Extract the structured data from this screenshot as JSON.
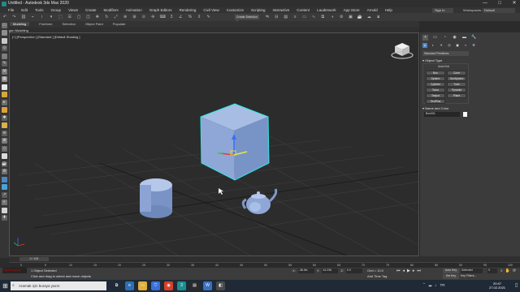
{
  "window": {
    "title": "Untitled - Autodesk 3ds Max 2020",
    "controls": [
      "—",
      "□",
      "✕"
    ]
  },
  "menubar": {
    "items": [
      "File",
      "Edit",
      "Tools",
      "Group",
      "Views",
      "Create",
      "Modifiers",
      "Animation",
      "Graph Editors",
      "Rendering",
      "Civil View",
      "Customize",
      "Scripting",
      "Interactive",
      "Content",
      "Lauderwork",
      "App Store",
      "Arnold",
      "Help"
    ],
    "signin": "Sign In",
    "workspaces_label": "Workspaces:",
    "workspaces_value": "Default"
  },
  "toolbar": {
    "selection_set": "Create Selection Se"
  },
  "ribbon": {
    "tabs": [
      "Modeling",
      "Freeform",
      "Selection",
      "Object Paint",
      "Populate"
    ],
    "active_tab": "Modeling",
    "sub_label": "Polygon Modeling"
  },
  "viewport": {
    "label": "[+] [Perspective ] [Standard ] [Default Shading ]"
  },
  "command_panel": {
    "tab_icons": [
      "+",
      "▭",
      "◔",
      "◉",
      "▬",
      "🔧"
    ],
    "category_icons": [
      "●",
      "◐",
      "☀",
      "◎",
      "▣",
      "≈",
      "⚙"
    ],
    "primitive_type": "Standard Primitives",
    "object_type_header": "Object Type",
    "autogrid": "AutoGrid",
    "object_buttons": [
      "Box",
      "Cone",
      "Sphere",
      "GeoSphere",
      "Cylinder",
      "Tube",
      "Torus",
      "Pyramid",
      "Teapot",
      "Plane",
      "TextPlus"
    ],
    "name_color_header": "Name and Color",
    "object_name": "Box001",
    "object_color": "#ffffff"
  },
  "timeline": {
    "slider": "0 / 100",
    "ticks": [
      "0",
      "5",
      "10",
      "15",
      "20",
      "25",
      "30",
      "35",
      "40",
      "45",
      "50",
      "55",
      "60",
      "65",
      "70",
      "75",
      "80",
      "85",
      "90",
      "95",
      "100"
    ]
  },
  "statusbar": {
    "maxscript": "MAXScript Mi",
    "status_line1": "1 Object Selected",
    "status_line2": "Click and drag to select and move objects",
    "x_label": "X:",
    "x_value": "-36.9in",
    "y_label": "Y:",
    "y_value": "24.236",
    "z_label": "Z:",
    "z_value": "0.0",
    "grid": "Grid = 10.0",
    "add_time_tag": "Add Time Tag",
    "autokey": "Auto Key",
    "selected": "Selected",
    "setkey": "Set Key",
    "key_filters": "Key Filters...",
    "frame": "0"
  },
  "taskbar": {
    "search_placeholder": "Aramak için buraya yazın",
    "clock_time": "20:47",
    "clock_date": "27.02.2021"
  },
  "colors": {
    "selection_highlight": "#2ee7e7",
    "object_fill": "#8aa6d6"
  }
}
